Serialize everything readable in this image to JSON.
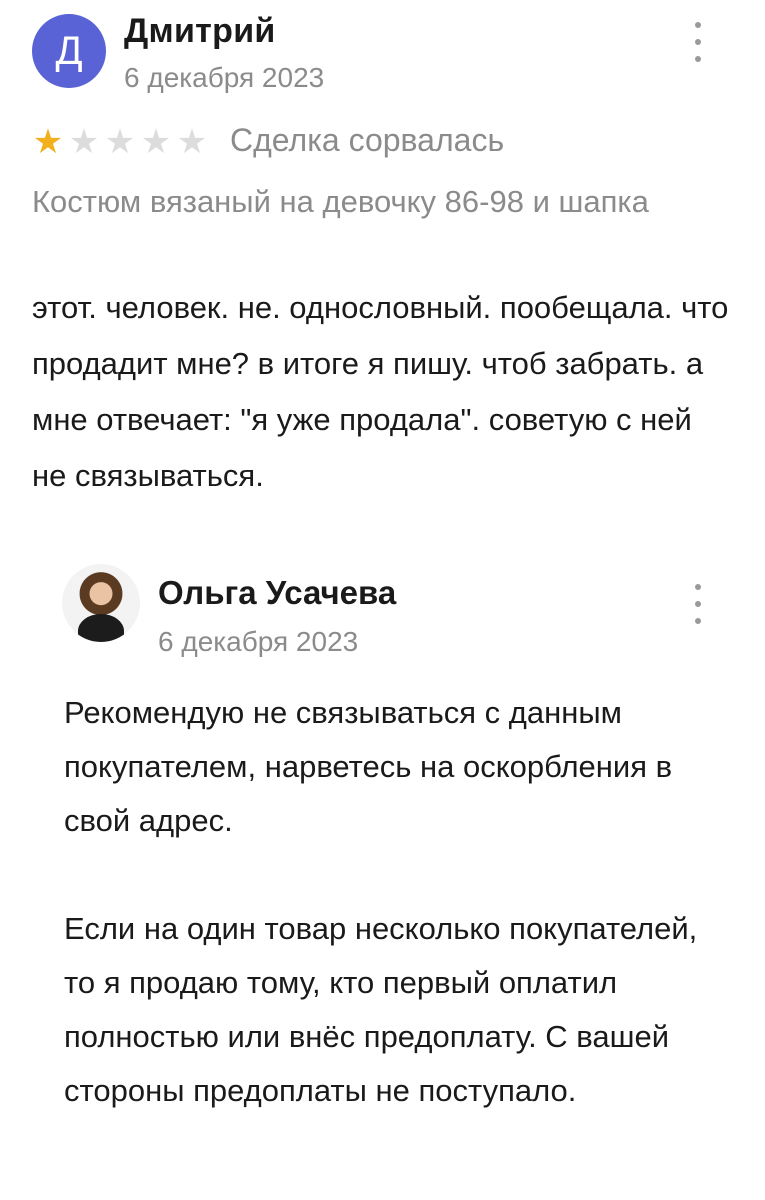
{
  "review": {
    "author": {
      "initial": "Д",
      "name": "Дмитрий",
      "avatar_color": "#5a63d6"
    },
    "date": "6 декабря 2023",
    "rating": {
      "value": 1,
      "max": 5,
      "filled_color": "#f2b01e",
      "empty_color": "#dcdcdc"
    },
    "deal_status": "Сделка сорвалась",
    "product": "Костюм вязаный на девочку 86-98 и шапка",
    "text": "этот. человек. не. однословный. пообещала. что продадит мне? в итоге я пишу. чтоб забрать. а мне отвечает: \"я уже продала\". советую с ней не связываться.",
    "more_icon": "more-vertical-icon"
  },
  "reply": {
    "author": {
      "name": "Ольга Усачева"
    },
    "date": "6 декабря 2023",
    "paragraphs": [
      "Рекомендую не связываться с данным покупателем, нарветесь на оскорбления в свой адрес.",
      "Если на один товар несколько покупателей, то я продаю тому, кто первый оплатил полностью или внёс предоплату. С вашей стороны предоплаты не поступало."
    ],
    "more_icon": "more-vertical-icon"
  }
}
